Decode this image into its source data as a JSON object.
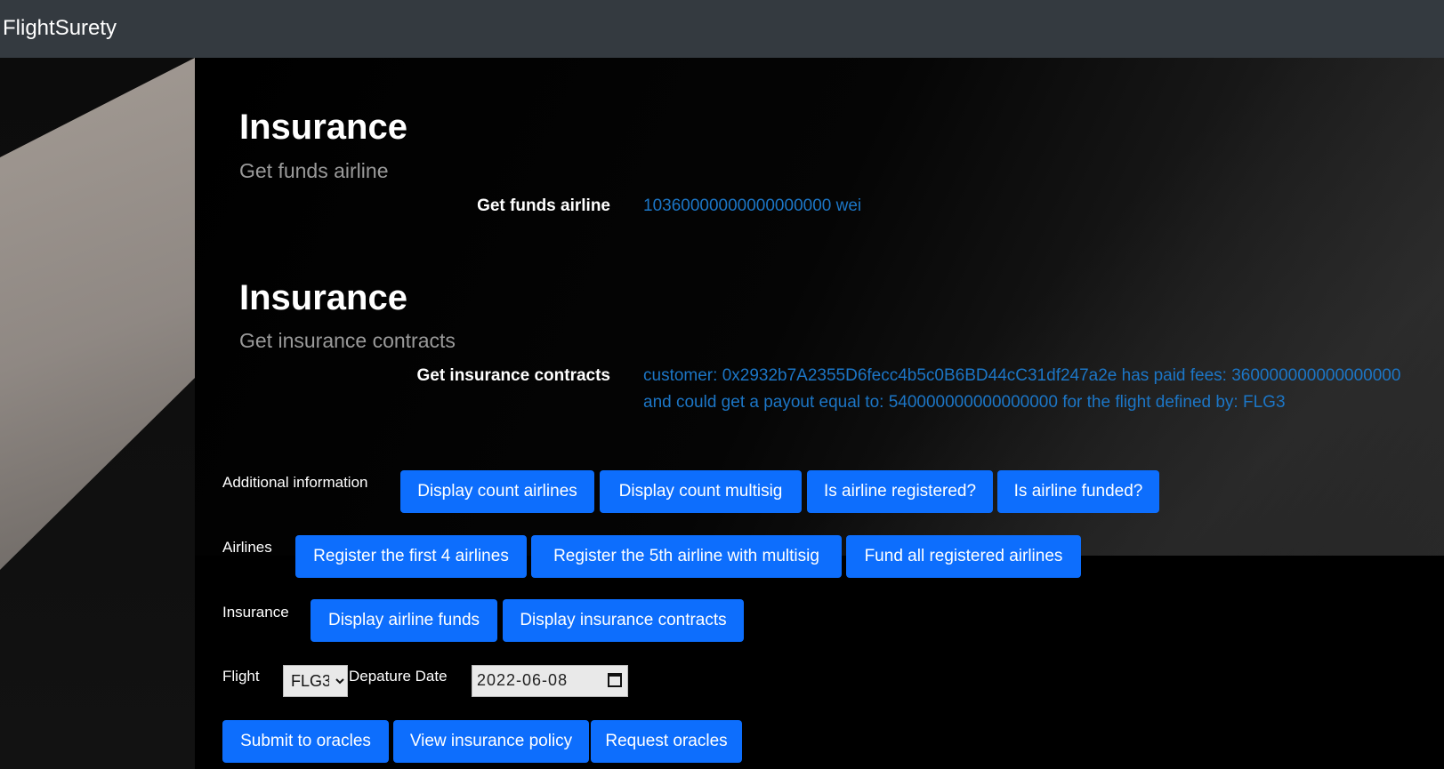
{
  "navbar": {
    "brand": "FlightSurety"
  },
  "sections": [
    {
      "title": "Insurance",
      "subtitle": "Get funds airline",
      "row_label": "Get funds airline",
      "row_value": "10360000000000000000 wei"
    },
    {
      "title": "Insurance",
      "subtitle": "Get insurance contracts",
      "row_label": "Get insurance contracts",
      "row_value_line1": "customer: 0x2932b7A2355D6fecc4b5c0B6BD44cC31df247a2e has paid fees: 360000000000000000",
      "row_value_line2": "and could get a payout equal to: 540000000000000000 for the flight defined by: FLG3"
    }
  ],
  "additional": {
    "label": "Additional information",
    "buttons": [
      "Display count airlines",
      "Display count multisig",
      "Is airline registered?",
      "Is airline funded?"
    ]
  },
  "airlines": {
    "label": "Airlines",
    "buttons": [
      "Register the first 4 airlines",
      "Register the 5th airline with multisig",
      "Fund all registered airlines"
    ]
  },
  "insurance": {
    "label": "Insurance",
    "buttons": [
      "Display airline funds",
      "Display insurance contracts"
    ]
  },
  "flight": {
    "label": "Flight",
    "selected": "FLG3",
    "date_label": "Depature Date",
    "date_value": "2022-06-08"
  },
  "actions": {
    "buttons": [
      "Submit to oracles",
      "View insurance policy",
      "Request oracles"
    ]
  },
  "colors": {
    "navbar_bg": "#343a40",
    "button_bg": "#0d6efd",
    "value_text": "#1c76c6"
  },
  "icons": {
    "date_picker": "calendar-icon",
    "select_caret": "chevron-down-icon"
  }
}
